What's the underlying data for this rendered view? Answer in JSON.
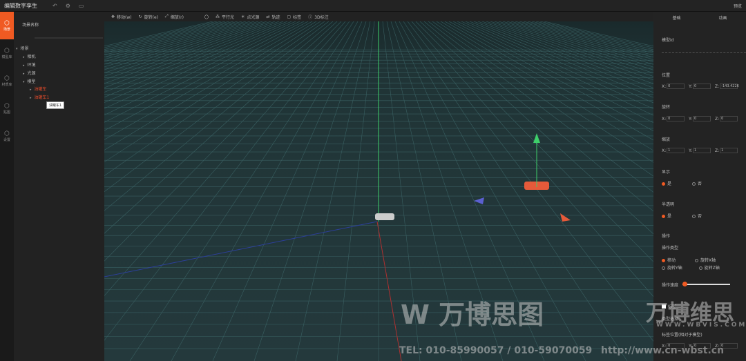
{
  "app": {
    "title": "编辑数字孪生",
    "preview": "预览"
  },
  "leftnav": [
    {
      "label": "场景",
      "icon": "scene-icon"
    },
    {
      "label": "模型库",
      "icon": "cube-icon"
    },
    {
      "label": "材质库",
      "icon": "cube-icon"
    },
    {
      "label": "贴图",
      "icon": "cube-icon"
    },
    {
      "label": "设置",
      "icon": "cube-icon"
    }
  ],
  "tree": {
    "header": "场景名称",
    "root": "场景",
    "children": [
      "相机",
      "环境",
      "光源",
      "模型"
    ],
    "models": [
      "油罐车",
      "油罐车1"
    ],
    "tooltip": "油罐车1"
  },
  "toolbar": [
    {
      "label": "移动(w)",
      "icon": "move-icon"
    },
    {
      "label": "旋转(e)",
      "icon": "rotate-icon"
    },
    {
      "label": "缩放(r)",
      "icon": "scale-icon"
    },
    {
      "label": "〇",
      "icon": "circle-icon"
    },
    {
      "label": "平行光",
      "icon": "light-icon"
    },
    {
      "label": "点光源",
      "icon": "sun-icon"
    },
    {
      "label": "轨迹",
      "icon": "track-icon"
    },
    {
      "label": "标签",
      "icon": "label-icon"
    },
    {
      "label": "3D标注",
      "icon": "info-icon"
    }
  ],
  "panel": {
    "tabs": [
      "基础",
      "动画"
    ],
    "model_id_label": "模型id",
    "position": {
      "label": "位置",
      "x": "0",
      "y": "0",
      "z": "-143.4226"
    },
    "rotation": {
      "label": "旋转",
      "x": "0",
      "y": "0",
      "z": "0"
    },
    "scale": {
      "label": "缩放",
      "x": "1",
      "y": "1",
      "z": "1"
    },
    "visible": {
      "label": "显示",
      "yes": "是",
      "no": "否"
    },
    "transparent": {
      "label": "半透明",
      "yes": "是",
      "no": "否"
    },
    "operation": {
      "label": "操作",
      "type_label": "操作类型",
      "types": [
        "移动",
        "旋转X轴",
        "旋转Y轴",
        "旋转Z轴"
      ],
      "speed_label": "操作速度",
      "speed": 0.05
    },
    "label": {
      "checkbox": "标签",
      "type": "类型选择",
      "pos_label": "标签位置(相对于模型)",
      "x": "0",
      "y": "0",
      "z": "0"
    }
  },
  "watermark": {
    "brand1": "万博思图",
    "brand2": "万博维思",
    "site2": "WWW.WBVIS.COM",
    "tel": "TEL: 010-85990057 / 010-59070059",
    "site": "http://www.cn-wbst.cn"
  }
}
